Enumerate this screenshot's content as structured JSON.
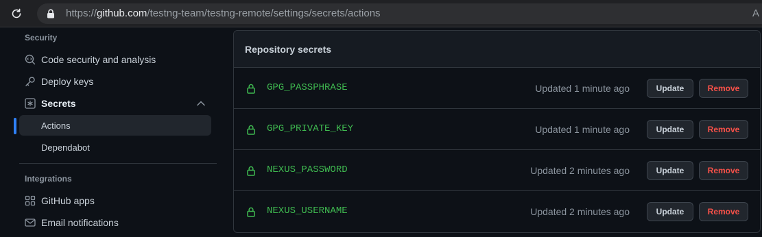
{
  "browser": {
    "url_prefix": "https://",
    "url_host": "github.com",
    "url_path": "/testng-team/testng-remote/settings/secrets/actions",
    "reader_glyph": "A"
  },
  "sidebar": {
    "security_title": "Security",
    "items": [
      {
        "label": "Code security and analysis",
        "icon": "codescan-icon"
      },
      {
        "label": "Deploy keys",
        "icon": "key-icon"
      },
      {
        "label": "Secrets",
        "icon": "asterisk-icon",
        "expanded": true
      },
      {
        "label": "Actions",
        "selected": true
      },
      {
        "label": "Dependabot"
      }
    ],
    "integrations_title": "Integrations",
    "integrations": [
      {
        "label": "GitHub apps",
        "icon": "apps-icon"
      },
      {
        "label": "Email notifications",
        "icon": "mail-icon"
      }
    ]
  },
  "panel": {
    "title": "Repository secrets",
    "update_label": "Update",
    "remove_label": "Remove",
    "secrets": [
      {
        "name": "GPG_PASSPHRASE",
        "updated": "Updated 1 minute ago"
      },
      {
        "name": "GPG_PRIVATE_KEY",
        "updated": "Updated 1 minute ago"
      },
      {
        "name": "NEXUS_PASSWORD",
        "updated": "Updated 2 minutes ago"
      },
      {
        "name": "NEXUS_USERNAME",
        "updated": "Updated 2 minutes ago"
      }
    ]
  },
  "colors": {
    "accent": "#2f81f7",
    "secret_name": "#3fb950",
    "danger": "#f85149"
  }
}
